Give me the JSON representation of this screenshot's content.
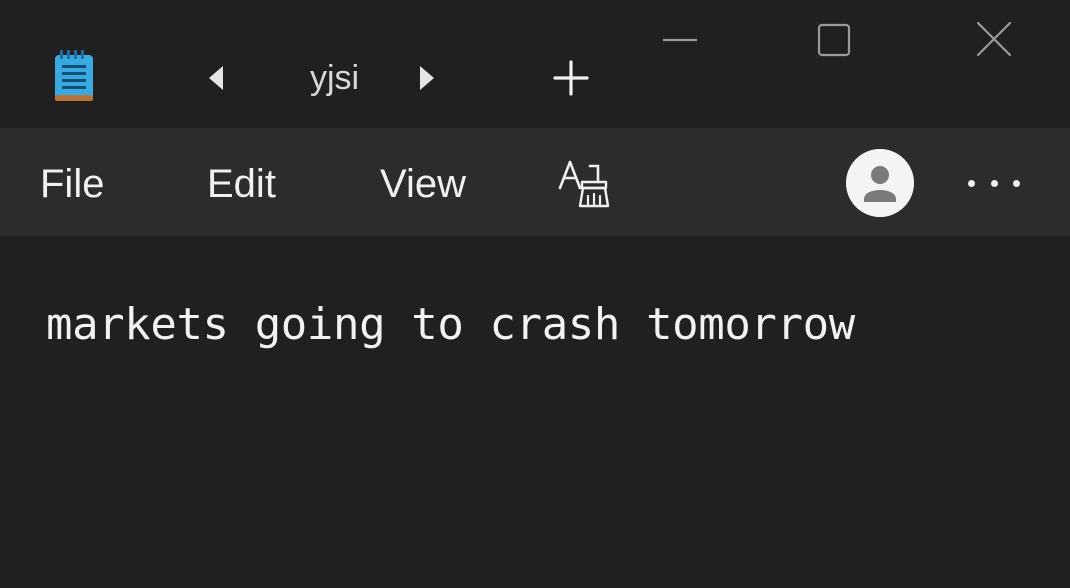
{
  "titlebar": {
    "app_icon": "notepad-icon",
    "tab_title": "yjsi",
    "prev_tab_icon": "caret-left-icon",
    "next_tab_icon": "caret-right-icon",
    "add_tab_icon": "plus-icon",
    "window_controls": [
      "minimize-icon",
      "maximize-icon",
      "close-icon"
    ]
  },
  "menubar": {
    "file_label": "File",
    "edit_label": "Edit",
    "view_label": "View",
    "font_icon": "font-format-icon",
    "account_icon": "user-avatar-icon",
    "more_icon": "more-horizontal-icon"
  },
  "editor": {
    "content": "markets going to crash tomorrow"
  },
  "colors": {
    "titlebar_bg": "#202020",
    "menubar_bg": "#2c2c2c",
    "editor_bg": "#202020",
    "text": "#f2f2f2",
    "app_icon_blue": "#39a9e0"
  }
}
